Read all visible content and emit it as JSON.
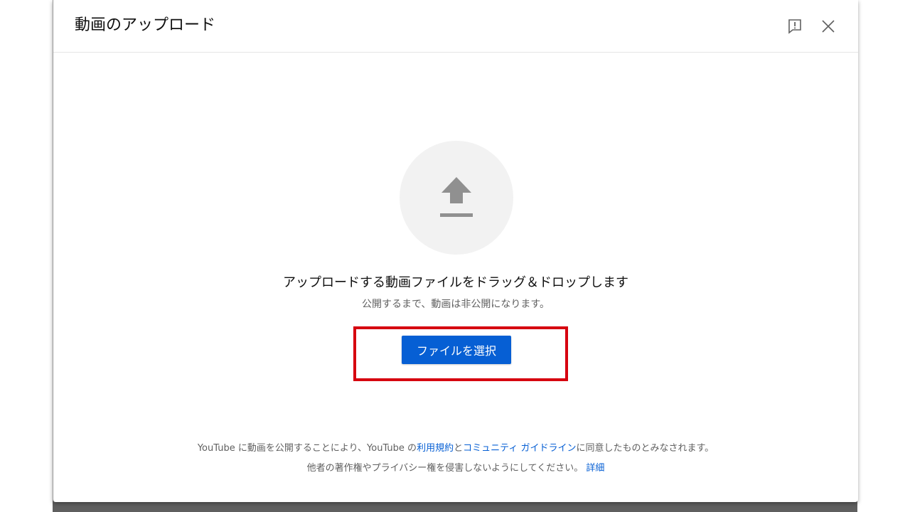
{
  "dialog": {
    "title": "動画のアップロード",
    "feedback_icon": "feedback-icon",
    "close_icon": "close-icon"
  },
  "upload": {
    "icon": "upload-arrow-icon",
    "main_text": "アップロードする動画ファイルをドラッグ＆ドロップします",
    "sub_text": "公開するまで、動画は非公開になります。",
    "button_label": "ファイルを選択"
  },
  "footer": {
    "line1_part1": "YouTube に動画を公開することにより、YouTube の",
    "terms_link": "利用規約",
    "line1_part2": "と",
    "guidelines_link": "コミュニティ ガイドライン",
    "line1_part3": "に同意したものとみなされます。",
    "line2_text": "他者の著作権やプライバシー権を侵害しないようにしてください。 ",
    "details_link": "詳細"
  },
  "colors": {
    "accent": "#065fd4",
    "highlight": "#d6000f"
  }
}
